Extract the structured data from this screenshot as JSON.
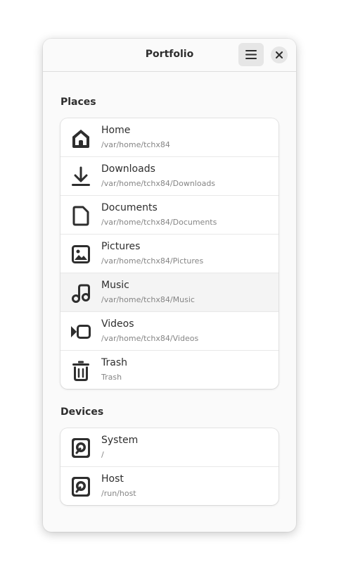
{
  "window": {
    "title": "Portfolio",
    "menu_icon": "hamburger-menu-icon",
    "close_icon": "close-icon"
  },
  "places": {
    "title": "Places",
    "items": [
      {
        "name": "Home",
        "path": "/var/home/tchx84",
        "icon": "home-icon"
      },
      {
        "name": "Downloads",
        "path": "/var/home/tchx84/Downloads",
        "icon": "download-icon"
      },
      {
        "name": "Documents",
        "path": "/var/home/tchx84/Documents",
        "icon": "document-icon"
      },
      {
        "name": "Pictures",
        "path": "/var/home/tchx84/Pictures",
        "icon": "picture-icon"
      },
      {
        "name": "Music",
        "path": "/var/home/tchx84/Music",
        "icon": "music-icon"
      },
      {
        "name": "Videos",
        "path": "/var/home/tchx84/Videos",
        "icon": "video-icon"
      },
      {
        "name": "Trash",
        "path": "Trash",
        "icon": "trash-icon"
      }
    ]
  },
  "devices": {
    "title": "Devices",
    "items": [
      {
        "name": "System",
        "path": "/",
        "icon": "drive-icon"
      },
      {
        "name": "Host",
        "path": "/run/host",
        "icon": "drive-icon"
      }
    ]
  },
  "colors": {
    "window_bg": "#fafafa",
    "card_bg": "#ffffff",
    "text": "#2e2e2e",
    "subtext": "#858585",
    "icon": "#2e2e2e"
  }
}
